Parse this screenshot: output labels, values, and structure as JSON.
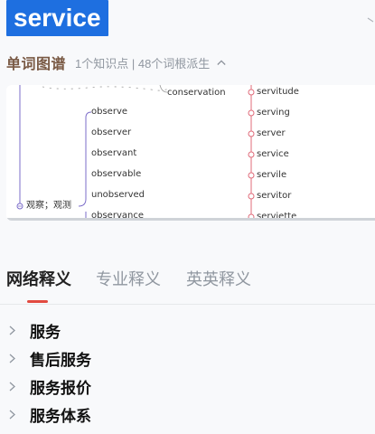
{
  "header": {
    "word": "service"
  },
  "etymology": {
    "title": "单词图谱",
    "meta": "1个知识点 | 48个词根派生",
    "mindmap": {
      "center_label": "观察；观测",
      "top_label": "conservation",
      "left_words": [
        "observe",
        "observer",
        "observant",
        "observable",
        "unobserved",
        "observance"
      ],
      "right_words": [
        "servitude",
        "serving",
        "server",
        "service",
        "servile",
        "servitor",
        "serviette"
      ]
    }
  },
  "tabs": [
    {
      "label": "网络释义",
      "active": true
    },
    {
      "label": "专业释义",
      "active": false
    },
    {
      "label": "英英释义",
      "active": false
    }
  ],
  "definitions": [
    {
      "label": "服务"
    },
    {
      "label": "售后服务"
    },
    {
      "label": "服务报价"
    },
    {
      "label": "服务体系"
    }
  ],
  "colors": {
    "badge_bg": "#1e6fe0",
    "section_title": "#7a5a45",
    "mindmap_left_line": "#7b6cc9",
    "mindmap_right_line": "#e06b7a",
    "tab_underline": "#e24a40"
  }
}
